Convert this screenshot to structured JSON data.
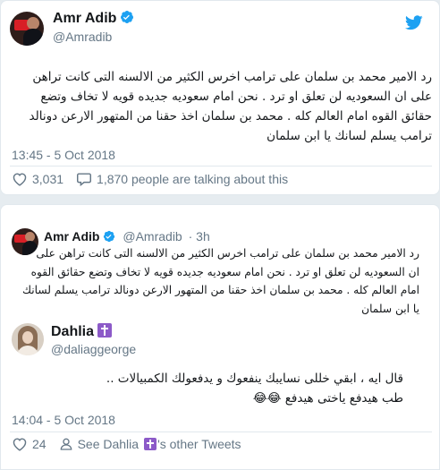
{
  "tweet1": {
    "author_name": "Amr Adib",
    "author_handle": "@Amradib",
    "verified": true,
    "text_lines": [
      "رد الامير محمد بن سلمان على ترامب اخرس الكثير من الالسنه التى كانت تراهن",
      "على ان السعوديه لن تعلق او ترد . نحن امام سعوديه جديده قويه لا تخاف وتضع",
      "حقائق القوه امام العالم كله . محمد بن سلمان اخذ حقنا من المتهور الارعن دونالد",
      "ترامب يسلم لسانك يا ابن سلمان"
    ],
    "timestamp": "13:45 - 5 Oct 2018",
    "likes": "3,031",
    "talking": "1,870 people are talking about this"
  },
  "tweet2": {
    "quoted": {
      "author_name": "Amr Adib",
      "author_handle": "@Amradib",
      "age": "· 3h",
      "text_lines": [
        "رد الامير محمد بن سلمان على ترامب اخرس الكثير من الالسنه التى كانت تراهن على",
        "ان السعوديه لن تعلق او ترد . نحن امام سعوديه جديده قويه لا تخاف وتضع حقائق القوه",
        "امام العالم كله . محمد بن سلمان اخذ حقنا من المتهور الارعن دونالد ترامب يسلم لسانك",
        "يا ابن سلمان"
      ]
    },
    "author_name": "Dahlia",
    "author_handle": "@daliaggeorge",
    "text_lines": [
      "قال ايه ، ابقي خللى نسايبك ينفعوك و يدفعولك الكمبيالات ..",
      "طب هيدفع ياختى هيدفع 😂😂"
    ],
    "timestamp": "14:04 - 5 Oct 2018",
    "likes": "24",
    "see_other_prefix": "See Dahlia",
    "see_other_suffix": "'s other Tweets"
  },
  "colors": {
    "twitter_blue": "#1da1f2",
    "text": "#14171a",
    "muted": "#657786",
    "border": "#e1e8ed",
    "cross_badge": "#8c5ac8"
  },
  "icons": [
    "twitter-bird-icon",
    "verified-badge-icon",
    "heart-icon",
    "comment-icon",
    "person-icon",
    "cross-badge-icon",
    "avatar-amr",
    "avatar-dahlia"
  ]
}
